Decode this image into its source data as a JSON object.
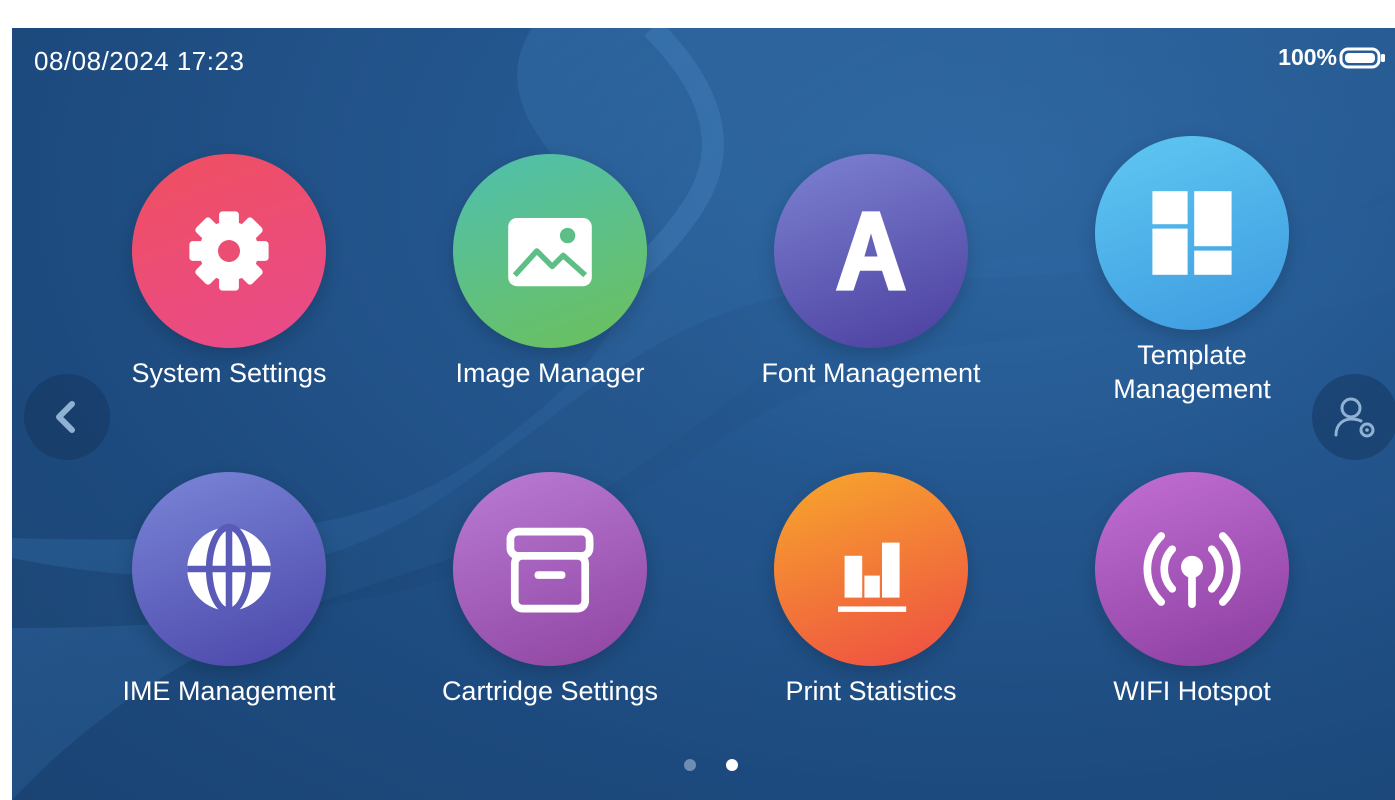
{
  "status_bar": {
    "datetime": "08/08/2024  17:23",
    "battery_percent": "100%",
    "battery_level": 1.0
  },
  "apps": [
    {
      "label": "System Settings",
      "icon": "gear-icon",
      "colors": [
        "#f0505f",
        "#e84a8c"
      ]
    },
    {
      "label": "Image Manager",
      "icon": "image-icon",
      "colors": [
        "#4fc0b0",
        "#6cc05a"
      ]
    },
    {
      "label": "Font Management",
      "icon": "font-letter-icon",
      "colors": [
        "#7d82d2",
        "#4a3e9e"
      ]
    },
    {
      "label": "Template\nManagement",
      "icon": "template-grid-icon",
      "colors": [
        "#5fc8f2",
        "#3d9ae0"
      ]
    },
    {
      "label": "IME Management",
      "icon": "globe-icon",
      "colors": [
        "#7a86d8",
        "#4a45a8"
      ]
    },
    {
      "label": "Cartridge Settings",
      "icon": "box-icon",
      "colors": [
        "#ba7cd6",
        "#8e44a0"
      ]
    },
    {
      "label": "Print Statistics",
      "icon": "bar-chart-icon",
      "colors": [
        "#f7a82c",
        "#ee4c43"
      ]
    },
    {
      "label": "WIFI Hotspot",
      "icon": "wifi-hotspot-icon",
      "colors": [
        "#c26fd4",
        "#8a3d9e"
      ]
    }
  ],
  "navigation": {
    "prev_icon": "chevron-left-icon",
    "user_icon": "user-settings-icon"
  },
  "pagination": {
    "total_pages": 2,
    "current_page": 2
  },
  "colors": {
    "dot_inactive": "#6f8db0",
    "dot_active": "#ffffff"
  }
}
